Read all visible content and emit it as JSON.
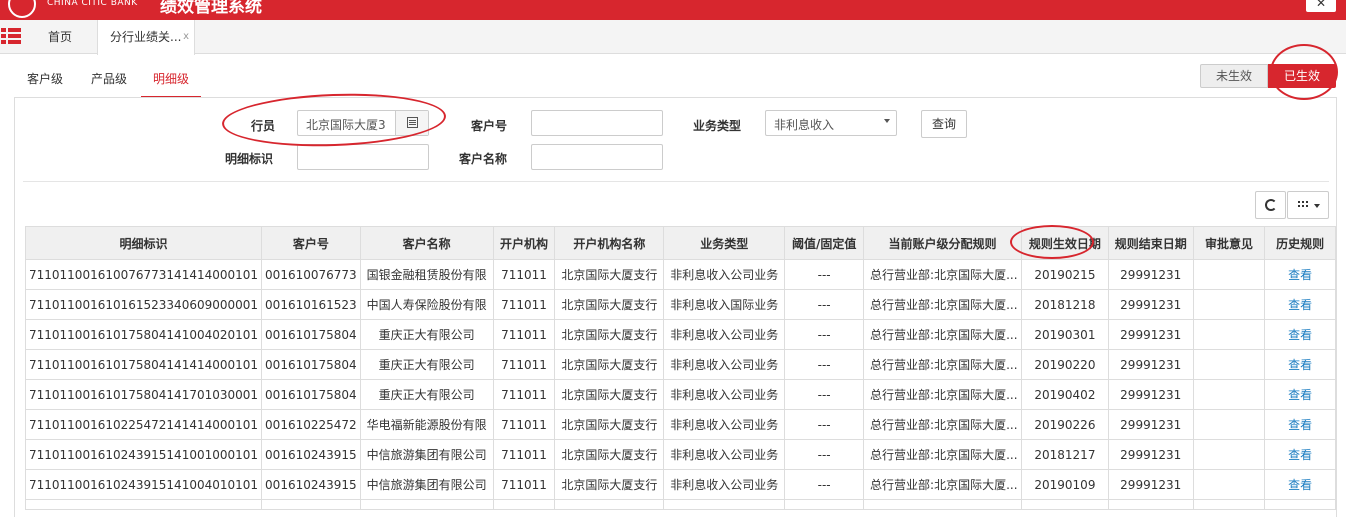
{
  "header": {
    "brand_en": "CHINA CITIC BANK",
    "brand_cn": "绩效管理系统",
    "top_button_icon": "close-icon"
  },
  "tabs": {
    "home": "首页",
    "active": "分行业绩关...",
    "close": "x"
  },
  "subtabs": [
    "客户级",
    "产品级",
    "明细级"
  ],
  "status": {
    "inactive": "未生效",
    "active": "已生效"
  },
  "form": {
    "staff_label": "行员",
    "staff_value": "北京国际大厦3",
    "customer_no_label": "客户号",
    "customer_no_value": "",
    "biz_type_label": "业务类型",
    "biz_type_value": "非利息收入",
    "query_button": "查询",
    "detail_id_label": "明细标识",
    "detail_id_value": "",
    "customer_name_label": "客户名称",
    "customer_name_value": ""
  },
  "table": {
    "headers": [
      "明细标识",
      "客户号",
      "客户名称",
      "开户机构",
      "开户机构名称",
      "业务类型",
      "阈值/固定值",
      "当前账户级分配规则",
      "规则生效日期",
      "规则结束日期",
      "审批意见",
      "历史规则"
    ],
    "rows": [
      [
        "711011001610076773141414000101",
        "001610076773",
        "国银金融租赁股份有限",
        "711011",
        "北京国际大厦支行",
        "非利息收入公司业务",
        "---",
        "总行营业部:北京国际大厦...",
        "20190215",
        "29991231",
        "",
        "查看"
      ],
      [
        "711011001610161523340609000001",
        "001610161523",
        "中国人寿保险股份有限",
        "711011",
        "北京国际大厦支行",
        "非利息收入国际业务",
        "---",
        "总行营业部:北京国际大厦...",
        "20181218",
        "29991231",
        "",
        "查看"
      ],
      [
        "711011001610175804141004020101",
        "001610175804",
        "重庆正大有限公司",
        "711011",
        "北京国际大厦支行",
        "非利息收入公司业务",
        "---",
        "总行营业部:北京国际大厦...",
        "20190301",
        "29991231",
        "",
        "查看"
      ],
      [
        "711011001610175804141414000101",
        "001610175804",
        "重庆正大有限公司",
        "711011",
        "北京国际大厦支行",
        "非利息收入公司业务",
        "---",
        "总行营业部:北京国际大厦...",
        "20190220",
        "29991231",
        "",
        "查看"
      ],
      [
        "711011001610175804141701030001",
        "001610175804",
        "重庆正大有限公司",
        "711011",
        "北京国际大厦支行",
        "非利息收入公司业务",
        "---",
        "总行营业部:北京国际大厦...",
        "20190402",
        "29991231",
        "",
        "查看"
      ],
      [
        "711011001610225472141414000101",
        "001610225472",
        "华电福新能源股份有限",
        "711011",
        "北京国际大厦支行",
        "非利息收入公司业务",
        "---",
        "总行营业部:北京国际大厦...",
        "20190226",
        "29991231",
        "",
        "查看"
      ],
      [
        "711011001610243915141001000101",
        "001610243915",
        "中信旅游集团有限公司",
        "711011",
        "北京国际大厦支行",
        "非利息收入公司业务",
        "---",
        "总行营业部:北京国际大厦...",
        "20181217",
        "29991231",
        "",
        "查看"
      ],
      [
        "711011001610243915141004010101",
        "001610243915",
        "中信旅游集团有限公司",
        "711011",
        "北京国际大厦支行",
        "非利息收入公司业务",
        "---",
        "总行营业部:北京国际大厦...",
        "20190109",
        "29991231",
        "",
        "查看"
      ]
    ]
  }
}
